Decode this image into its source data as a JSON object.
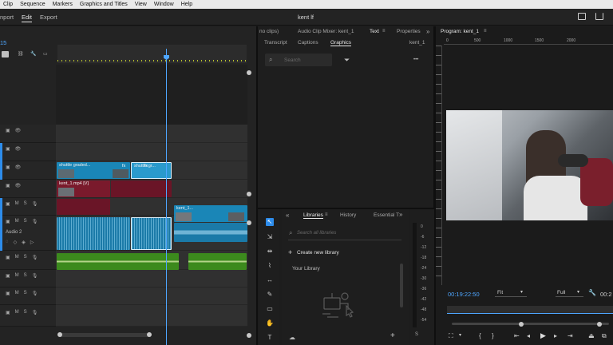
{
  "menu": [
    "Clip",
    "Sequence",
    "Markers",
    "Graphics and Titles",
    "View",
    "Window",
    "Help"
  ],
  "workspace": {
    "tabs": [
      "nport",
      "Edit",
      "Export"
    ],
    "title": "kent lf"
  },
  "timeline": {
    "timecode": "15",
    "track_labels": {
      "audio2": "Audio 2"
    },
    "clips": {
      "shuttle1": "shuttle graded...",
      "shuttle2": "shuttle gr...",
      "kent_v": "kent_1.mp4 [V]",
      "kent_small": "kent_1..."
    },
    "fx": "fx"
  },
  "source_panel": {
    "tabs": [
      "no clips)",
      "Audio Clip Mixer: kent_1",
      "Text",
      "Properties"
    ],
    "subtabs": [
      "Transcript",
      "Captions",
      "Graphics"
    ],
    "clip_name": "kent_1",
    "search_placeholder": "Search",
    "more": "•••",
    "expand": "»"
  },
  "program": {
    "title": "Program: kent_1",
    "ruler": [
      "0",
      "500",
      "1000",
      "1500",
      "2000"
    ],
    "timecode": "00:19:22:50",
    "fit": "Fit",
    "quality": "Full",
    "end_timecode": "00:2"
  },
  "libraries": {
    "tabs": [
      "Libraries",
      "History",
      "Essential T"
    ],
    "search_placeholder": "Search all libraries",
    "create_label": "Create new library",
    "your_library": "Your Library",
    "add": "+"
  },
  "meter": {
    "ticks": [
      "0",
      "-6",
      "-12",
      "-18",
      "-24",
      "-30",
      "-36",
      "-42",
      "-48",
      "-54"
    ]
  },
  "colors": {
    "accent": "#2d8ceb",
    "video_clip": "#1a86b7",
    "audio_green": "#4c9a28",
    "clip_red": "#7a1a2c",
    "playhead": "#4ea6ff"
  }
}
